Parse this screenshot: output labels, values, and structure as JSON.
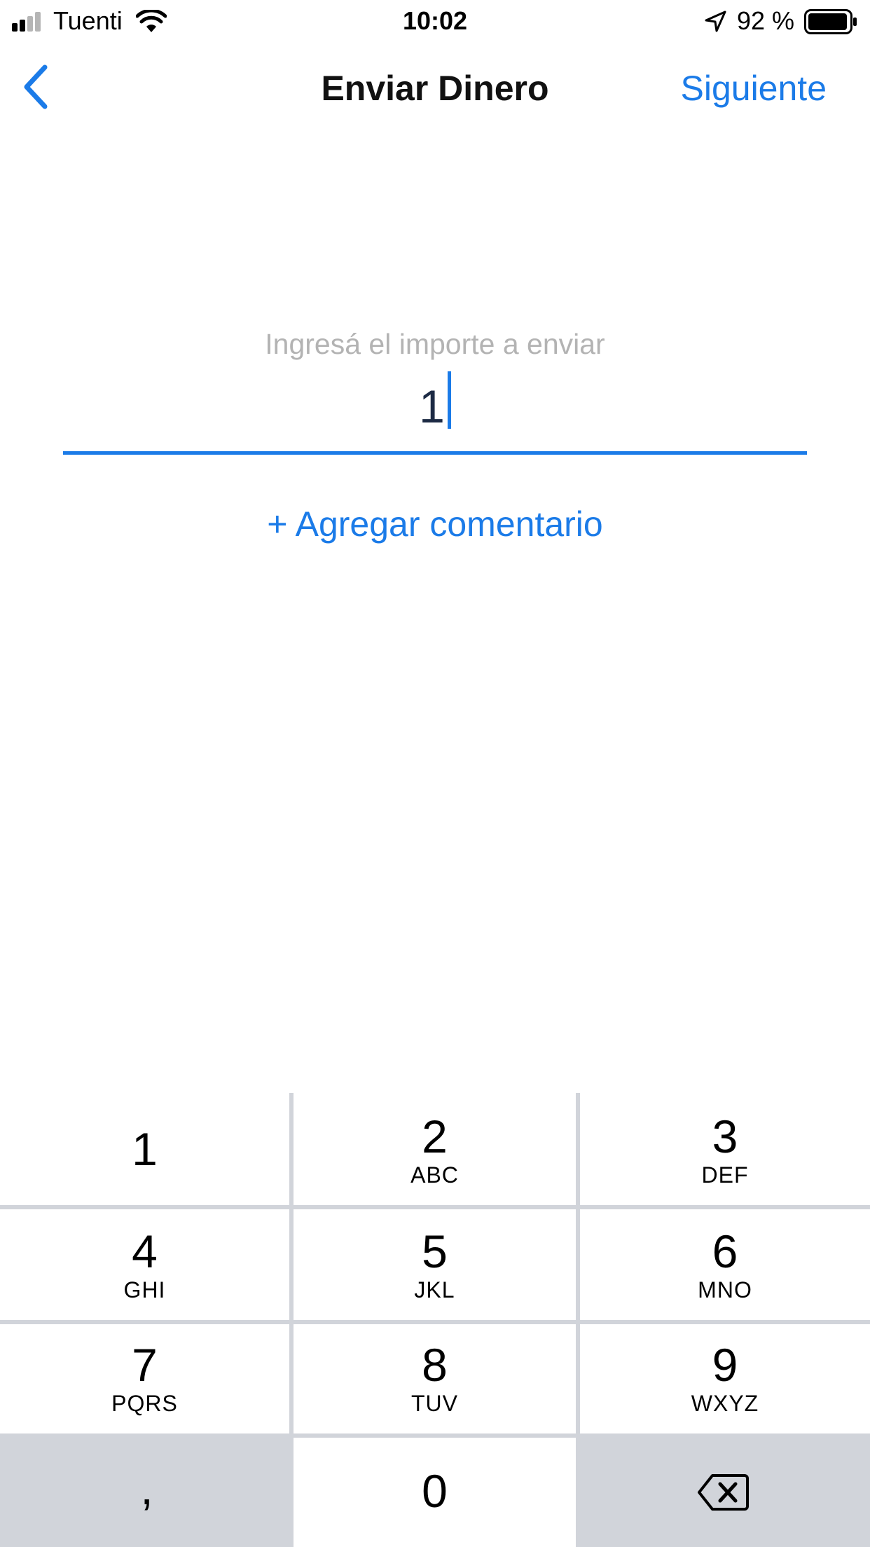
{
  "status_bar": {
    "carrier": "Tuenti",
    "time": "10:02",
    "battery_percent": "92 %"
  },
  "nav": {
    "title": "Enviar Dinero",
    "next_label": "Siguiente"
  },
  "amount": {
    "placeholder": "Ingresá el importe a enviar",
    "value": "1"
  },
  "add_comment_label": "+ Agregar comentario",
  "keypad": {
    "keys": [
      {
        "digit": "1",
        "letters": ""
      },
      {
        "digit": "2",
        "letters": "ABC"
      },
      {
        "digit": "3",
        "letters": "DEF"
      },
      {
        "digit": "4",
        "letters": "GHI"
      },
      {
        "digit": "5",
        "letters": "JKL"
      },
      {
        "digit": "6",
        "letters": "MNO"
      },
      {
        "digit": "7",
        "letters": "PQRS"
      },
      {
        "digit": "8",
        "letters": "TUV"
      },
      {
        "digit": "9",
        "letters": "WXYZ"
      }
    ],
    "comma": ",",
    "zero": "0"
  },
  "colors": {
    "accent": "#1b7be8",
    "placeholder": "#b3b3b3",
    "keypad_background": "#d1d4da"
  },
  "icons": {
    "back": "chevron-left-icon",
    "backspace": "backspace-icon",
    "signal": "cellular-signal-icon",
    "wifi": "wifi-icon",
    "location": "location-arrow-icon",
    "battery": "battery-icon"
  }
}
